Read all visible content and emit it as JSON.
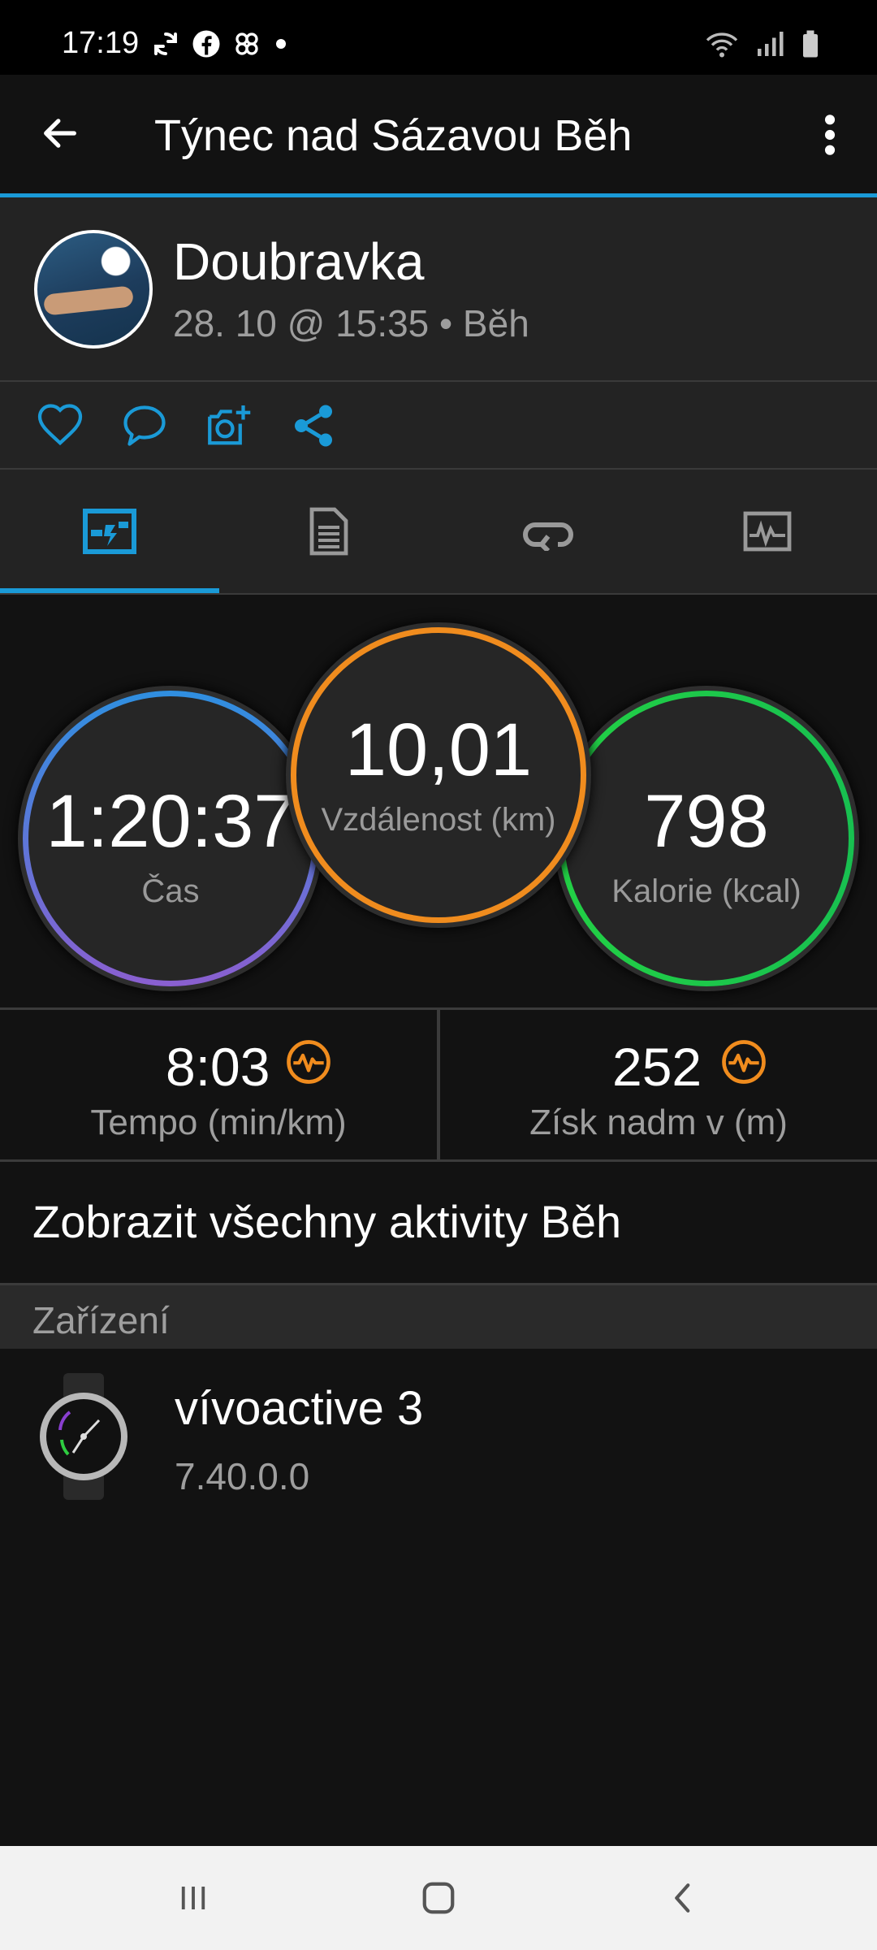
{
  "status_bar": {
    "time": "17:19",
    "icons": [
      "sync-icon",
      "facebook-icon",
      "pinwheel-icon",
      "dot-icon"
    ],
    "right_icons": [
      "wifi-icon",
      "signal-icon",
      "battery-icon"
    ]
  },
  "app_bar": {
    "back_icon": "arrow-left-icon",
    "title": "Týnec nad Sázavou Běh",
    "menu_icon": "more-vertical-icon"
  },
  "profile": {
    "name": "Doubravka",
    "meta": "28. 10 @ 15:35 • Běh"
  },
  "actions": [
    "heart-icon",
    "comment-icon",
    "add-photo-icon",
    "share-icon"
  ],
  "tabs": {
    "items": [
      "overview-chart-icon",
      "details-document-icon",
      "laps-loop-icon",
      "graph-chart-icon"
    ],
    "selected_index": 0
  },
  "stats": {
    "time": {
      "value": "1:20:37",
      "label": "Čas"
    },
    "distance": {
      "value": "10,01",
      "label": "Vzdálenost (km)"
    },
    "calories": {
      "value": "798",
      "label": "Kalorie (kcal)"
    }
  },
  "metrics": {
    "pace": {
      "value": "8:03",
      "label": "Tempo (min/km)"
    },
    "elevation": {
      "value": "252",
      "label": "Získ nadm v (m)"
    }
  },
  "link": {
    "text": "Zobrazit všechny aktivity Běh"
  },
  "section": {
    "title": "Zařízení"
  },
  "device": {
    "name": "vívoactive 3",
    "version": "7.40.0.0"
  },
  "nav_bar": [
    "recent-apps-icon",
    "home-icon",
    "back-icon"
  ],
  "colors": {
    "accent_blue": "#1a9ad7",
    "orange": "#f08c1e",
    "green": "#22d045",
    "gradient_blue": "#2f8fe0",
    "gradient_purple": "#8a5fd0"
  }
}
